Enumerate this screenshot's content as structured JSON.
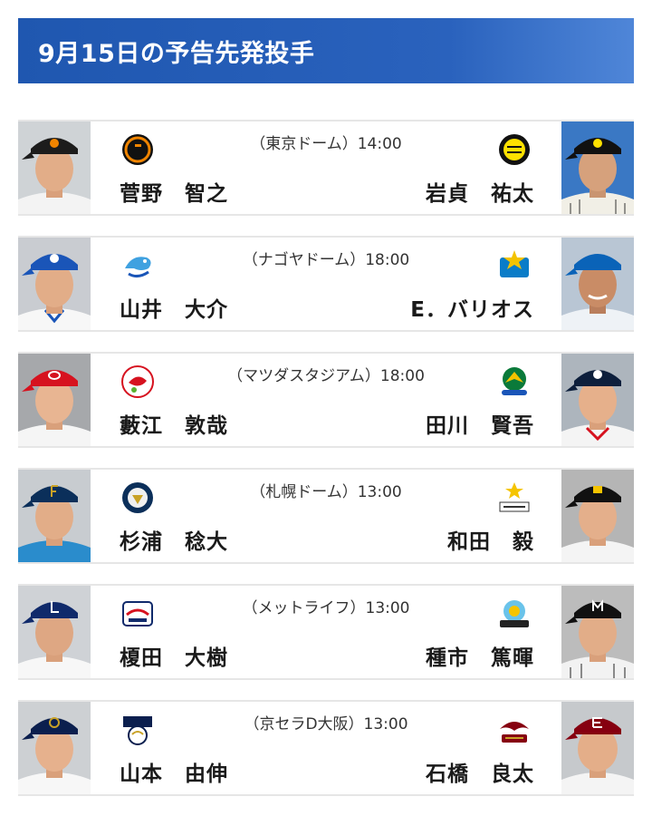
{
  "header": {
    "title": "9月15日の予告先発投手"
  },
  "colors": {
    "header_blue": "#1f57b0",
    "divider": "#e6e6e6"
  },
  "games": [
    {
      "venue": "（東京ドーム）14:00",
      "home": {
        "pitcher": "菅野　智之",
        "logo": "giants-logo",
        "team_color": "#f08400"
      },
      "away": {
        "pitcher": "岩貞　祐太",
        "logo": "tigers-logo",
        "team_color": "#ffe100"
      }
    },
    {
      "venue": "（ナゴヤドーム）18:00",
      "home": {
        "pitcher": "山井　大介",
        "logo": "dragons-logo",
        "team_color": "#1a55b8"
      },
      "away": {
        "pitcher": "E．バリオス",
        "logo": "baystars-logo",
        "team_color": "#0a7cc8"
      }
    },
    {
      "venue": "（マツダスタジアム）18:00",
      "home": {
        "pitcher": "藪江　敦哉",
        "logo": "carp-logo",
        "team_color": "#d6121f"
      },
      "away": {
        "pitcher": "田川　賢吾",
        "logo": "swallows-logo",
        "team_color": "#0a7a3a"
      }
    },
    {
      "venue": "（札幌ドーム）13:00",
      "home": {
        "pitcher": "杉浦　稔大",
        "logo": "fighters-logo",
        "team_color": "#0b2f5a"
      },
      "away": {
        "pitcher": "和田　毅",
        "logo": "hawks-logo",
        "team_color": "#f5c400"
      }
    },
    {
      "venue": "（メットライフ）13:00",
      "home": {
        "pitcher": "榎田　大樹",
        "logo": "lions-logo",
        "team_color": "#102a6b"
      },
      "away": {
        "pitcher": "種市　篤暉",
        "logo": "marines-logo",
        "team_color": "#222222"
      }
    },
    {
      "venue": "（京セラD大阪）13:00",
      "home": {
        "pitcher": "山本　由伸",
        "logo": "buffaloes-logo",
        "team_color": "#0b1f4e"
      },
      "away": {
        "pitcher": "石橋　良太",
        "logo": "eagles-logo",
        "team_color": "#860010"
      }
    }
  ]
}
